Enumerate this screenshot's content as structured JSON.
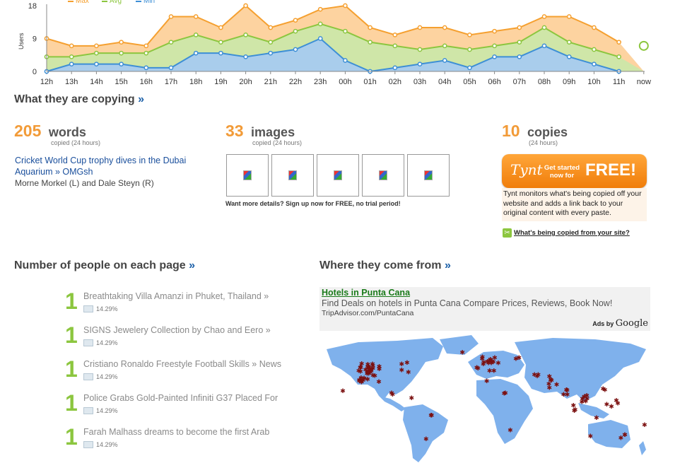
{
  "chart_data": {
    "type": "area",
    "legend": [
      "Max",
      "Avg",
      "Min"
    ],
    "ylabel": "Users",
    "yticks": [
      "18",
      "9",
      "0"
    ],
    "ylim": [
      0,
      18
    ],
    "x": [
      "12h",
      "13h",
      "14h",
      "15h",
      "16h",
      "17h",
      "18h",
      "19h",
      "20h",
      "21h",
      "22h",
      "23h",
      "00h",
      "01h",
      "02h",
      "03h",
      "04h",
      "05h",
      "06h",
      "07h",
      "08h",
      "09h",
      "10h",
      "11h",
      "now"
    ],
    "series": [
      {
        "name": "Max",
        "color": "#f5a030",
        "values": [
          9,
          7,
          7,
          8,
          7,
          15,
          15,
          12,
          18,
          12,
          14,
          17,
          18,
          12,
          10,
          12,
          12,
          10,
          11,
          12,
          15,
          15,
          12,
          8
        ]
      },
      {
        "name": "Avg",
        "color": "#8cc63f",
        "values": [
          4,
          4,
          5,
          5,
          5,
          8,
          10,
          8,
          10,
          8,
          11,
          13,
          11,
          8,
          7,
          6,
          7,
          6,
          7,
          8,
          12,
          8,
          6,
          4
        ]
      },
      {
        "name": "Min",
        "color": "#3d8fd6",
        "values": [
          0,
          2,
          2,
          2,
          1,
          1,
          5,
          5,
          4,
          5,
          6,
          9,
          3,
          0,
          1,
          2,
          3,
          1,
          4,
          4,
          7,
          4,
          2,
          0
        ]
      }
    ],
    "now_value": 7,
    "grid": false
  },
  "copying": {
    "heading": "What they are copying",
    "arrow": "»",
    "words": {
      "count": "205",
      "label": "words",
      "sub": "copied (24 hours)"
    },
    "images": {
      "count": "33",
      "label": "images",
      "sub": "copied (24 hours)"
    },
    "copies": {
      "count": "10",
      "label": "copies",
      "sub": "(24 hours)"
    },
    "article_link": "Cricket World Cup trophy dives in the Dubai Aquarium » OMGsh",
    "article_text": "Morne Morkel (L) and Dale Steyn (R)",
    "more_details": "Want more details? Sign up now for FREE, no trial period!"
  },
  "tynt": {
    "logo": "Tynt",
    "get_started": "Get started now for",
    "free": "FREE!",
    "desc": "Tynt monitors what's being copied off your website and adds a link back to your original content with every paste.",
    "link": "What's being copied from your site?",
    "accent": "#f07d0a"
  },
  "people": {
    "heading": "Number of people on each page",
    "arrow": "»",
    "items": [
      {
        "count": "1",
        "title": "Breathtaking Villa Amanzi in Phuket, Thailand »",
        "pct": "14.29%"
      },
      {
        "count": "1",
        "title": "SIGNS Jewelery Collection by Chao and Eero »",
        "pct": "14.29%"
      },
      {
        "count": "1",
        "title": "Cristiano Ronaldo Freestyle Football Skills » News",
        "pct": "14.29%"
      },
      {
        "count": "1",
        "title": "Police Grabs Gold-Painted Infiniti G37 Placed For",
        "pct": "14.29%"
      },
      {
        "count": "1",
        "title": "Farah Malhass dreams to become the first Arab",
        "pct": "14.29%"
      }
    ]
  },
  "where": {
    "heading": "Where they come from",
    "arrow": "»",
    "ad_title": "Hotels in Punta Cana",
    "ad_text": "Find Deals on hotels in Punta Cana Compare Prices, Reviews, Book Now!",
    "ad_url": "TripAdvisor.com/PuntaCana",
    "ads_by": "Ads by",
    "google": "Google"
  }
}
